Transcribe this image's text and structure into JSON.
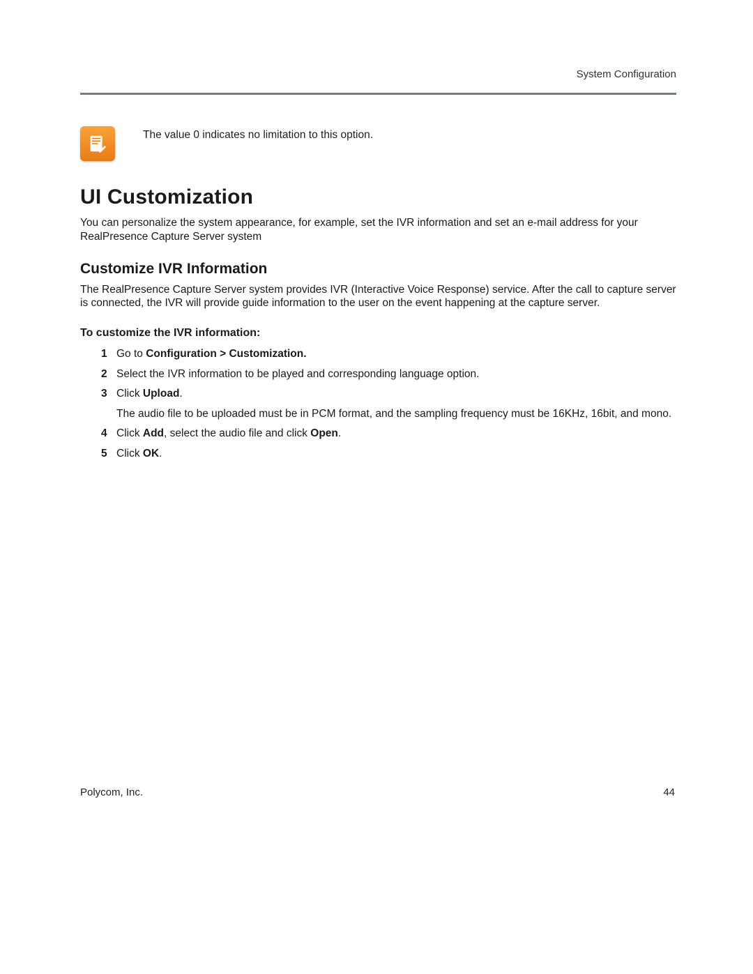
{
  "header": {
    "section": "System Configuration"
  },
  "note": {
    "text": "The value 0 indicates no limitation to this option."
  },
  "h1": "UI Customization",
  "intro": "You can personalize the system appearance, for example, set the IVR information and set an e-mail address for your RealPresence Capture Server system",
  "h2": "Customize IVR Information",
  "ivr_desc": "The RealPresence Capture Server system provides IVR (Interactive Voice Response) service. After the call to capture server is connected, the IVR will provide guide information to the user on the event happening at the capture server.",
  "h3": "To customize the IVR information:",
  "steps": {
    "s1_a": "Go to ",
    "s1_b": "Configuration > Customization.",
    "s2": "Select the IVR information to be played and corresponding language option.",
    "s3_a": "Click ",
    "s3_b": "Upload",
    "s3_c": ".",
    "s3_sub": "The audio file to be uploaded must be in PCM format, and the sampling frequency must be 16KHz, 16bit, and mono.",
    "s4_a": "Click ",
    "s4_b": "Add",
    "s4_c": ", select the audio file and click ",
    "s4_d": "Open",
    "s4_e": ".",
    "s5_a": "Click ",
    "s5_b": "OK",
    "s5_c": "."
  },
  "footer": {
    "company": "Polycom, Inc.",
    "page": "44"
  }
}
